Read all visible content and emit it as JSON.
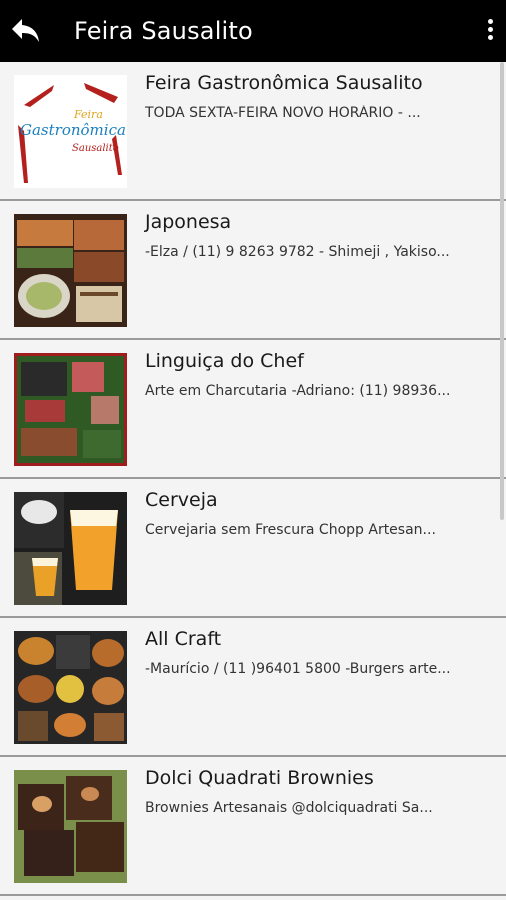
{
  "appbar": {
    "title": "Feira Sausalito",
    "back_icon": "back-arrow-icon",
    "more_icon": "more-vert-icon"
  },
  "items": [
    {
      "title": "Feira Gastronômica Sausalito",
      "subtitle": "TODA SEXTA-FEIRA NOVO HORÁRIO - ...",
      "logo_line1": "Feira",
      "logo_line2": "Gastronômica",
      "logo_line3": "Sausalito"
    },
    {
      "title": "Japonesa",
      "subtitle": "-Elza / (11) 9 8263 9782 - Shimeji , Yakiso..."
    },
    {
      "title": "Linguiça do Chef",
      "subtitle": "Arte em Charcutaria -Adriano: (11) 98936..."
    },
    {
      "title": "Cerveja",
      "subtitle": "Cervejaria sem Frescura Chopp Artesan..."
    },
    {
      "title": "All Craft",
      "subtitle": "-Maurício / (11 )96401 5800 -Burgers arte..."
    },
    {
      "title": "Dolci Quadrati Brownies",
      "subtitle": "Brownies Artesanais @dolciquadrati Sa..."
    }
  ],
  "colors": {
    "appbar": "#000000",
    "list_bg": "#f4f4f4",
    "divider": "#9a9a9a"
  }
}
